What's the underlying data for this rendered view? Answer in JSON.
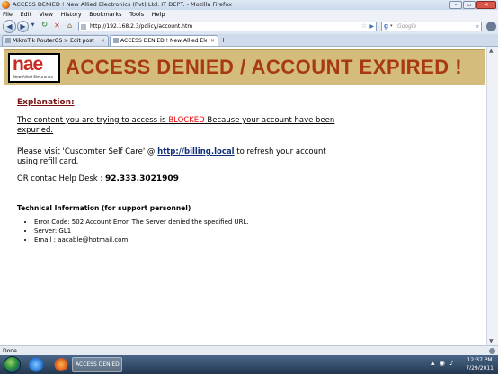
{
  "window": {
    "title": "ACCESS DENIED ! New Allied Electronics (Pvt) Ltd. IT DEPT. - Mozilla Firefox"
  },
  "menu": [
    "File",
    "Edit",
    "View",
    "History",
    "Bookmarks",
    "Tools",
    "Help"
  ],
  "navbar": {
    "url": "http://192.168.2.3/policy/account.htm",
    "search_engine": "Google",
    "search_placeholder": "Google"
  },
  "tabs": [
    {
      "label": "MikroTik RouterOS > Edit post",
      "active": false
    },
    {
      "label": "ACCESS DENIED ! New Allied Elec...",
      "active": true
    }
  ],
  "banner": {
    "logo_text": "nae",
    "logo_subtitle": "New Allied Electronics",
    "title": "ACCESS DENIED / ACCOUNT EXPIRED !"
  },
  "content": {
    "explanation_heading": "Explanation:",
    "blocked_prefix": "The content you are trying to access is ",
    "blocked_word": "BLOCKED",
    "blocked_suffix": " Because your account have been expuried.",
    "visit_prefix": "Please visit 'Cuscomter Self Care' @ ",
    "visit_link": "http://billing.local",
    "visit_suffix": " to refresh your account using refill card.",
    "helpdesk_label": "OR contac Help Desk : ",
    "helpdesk_number": "92.333.3021909",
    "tech_heading": "Technical Information (for support personnel)",
    "tech_items": [
      "Error Code: 502 Account Error. The Server denied the specified URL.",
      "Server: GL1",
      "Email : aacable@hotmail.com"
    ]
  },
  "status": {
    "text": "Done"
  },
  "taskbar": {
    "task_label": "ACCESS DENIED ...",
    "time": "12:37 PM",
    "date": "7/29/2011"
  },
  "colors": {
    "banner_bg": "#d4bc7c",
    "banner_title": "#a83a12",
    "blocked": "#e00000",
    "link": "#12307a"
  }
}
